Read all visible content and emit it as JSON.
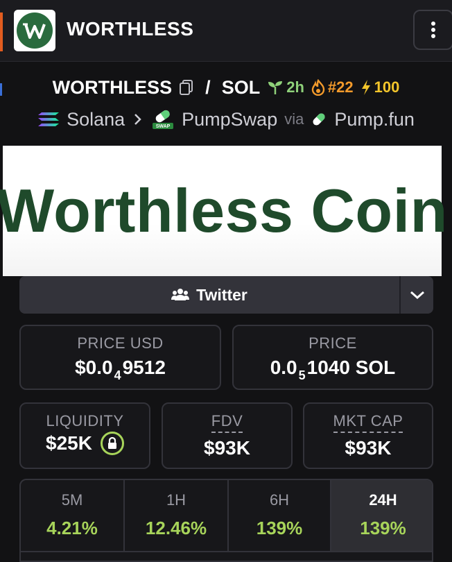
{
  "header": {
    "app_title": "WORTHLESS",
    "logo_letter": "W",
    "menu_icon": "kebab-menu-icon"
  },
  "pair": {
    "base": "WORTHLESS",
    "separator": "/",
    "quote": "SOL",
    "age": "2h",
    "trending_rank": "#22",
    "boost": "100",
    "colors": {
      "age": "#8fd17a",
      "rank": "#f39a2b",
      "boost": "#f3c52b"
    }
  },
  "chain": {
    "network": "Solana",
    "dex": "PumpSwap",
    "via_label": "via",
    "launchpad": "Pump.fun"
  },
  "banner": {
    "text": "Worthless Coin"
  },
  "social": {
    "label": "Twitter"
  },
  "stats": {
    "price_usd": {
      "label": "PRICE USD",
      "prefix": "$0.0",
      "zeros": "4",
      "digits": "9512"
    },
    "price_native": {
      "label": "PRICE",
      "prefix": "0.0",
      "zeros": "5",
      "digits": "1040 SOL"
    },
    "liquidity": {
      "label": "LIQUIDITY",
      "value": "$25K"
    },
    "fdv": {
      "label": "FDV",
      "value": "$93K"
    },
    "mkt_cap": {
      "label": "MKT CAP",
      "value": "$93K"
    }
  },
  "timeframes": [
    {
      "label": "5M",
      "change": "4.21%"
    },
    {
      "label": "1H",
      "change": "12.46%"
    },
    {
      "label": "6H",
      "change": "139%"
    },
    {
      "label": "24H",
      "change": "139%",
      "active": true
    }
  ],
  "accent_color": "#a7d45a"
}
